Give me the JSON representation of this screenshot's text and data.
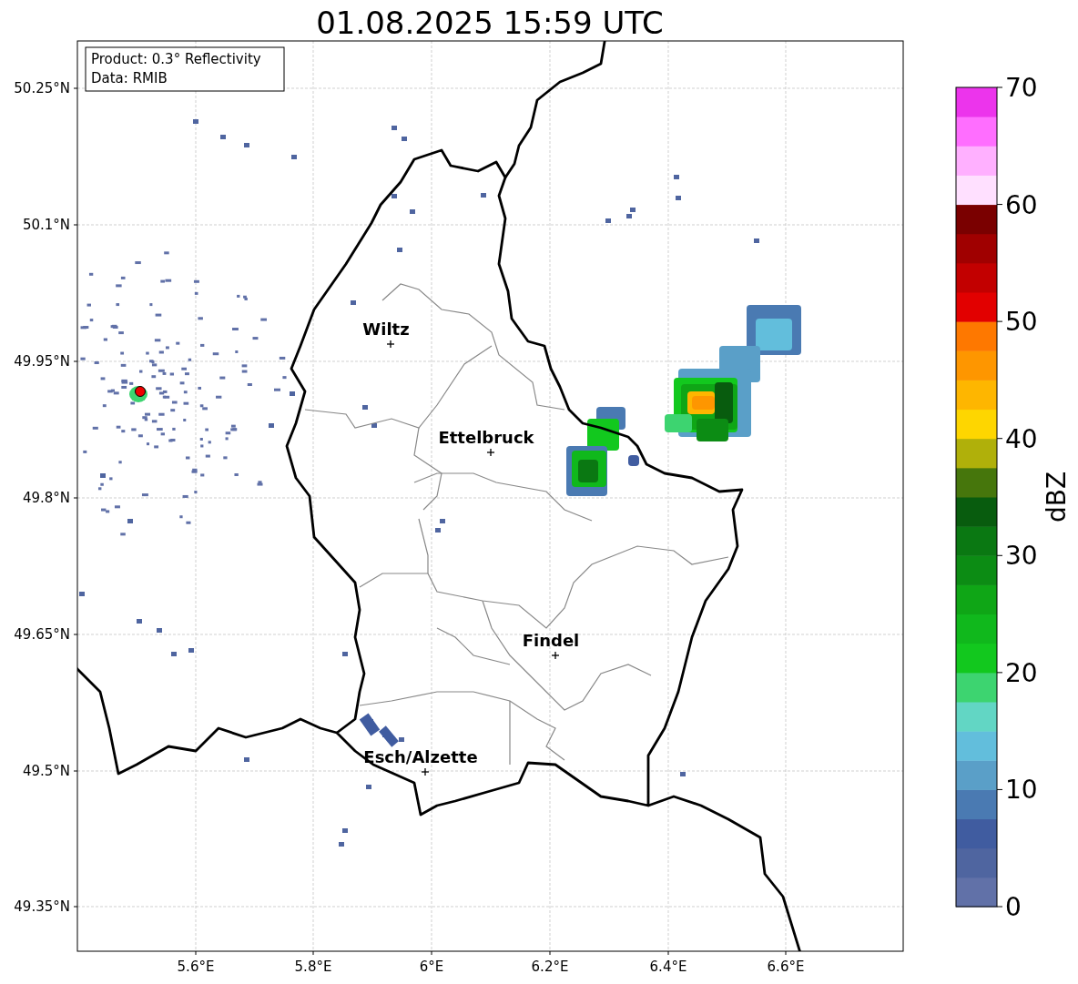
{
  "title": "01.08.2025 15:59 UTC",
  "info": [
    "Product: 0.3° Reflectivity",
    "Data: RMIB"
  ],
  "lat_ticks": [
    "50.25°N",
    "50.1°N",
    "49.95°N",
    "49.8°N",
    "49.65°N",
    "49.5°N",
    "49.35°N"
  ],
  "lon_ticks": [
    "5.6°E",
    "5.8°E",
    "6°E",
    "6.2°E",
    "6.4°E",
    "6.6°E"
  ],
  "cities": [
    {
      "name": "Wiltz"
    },
    {
      "name": "Ettelbruck"
    },
    {
      "name": "Findel"
    },
    {
      "name": "Esch/Alzette"
    }
  ],
  "colorbar": {
    "label": "dBZ",
    "ticks": [
      "70",
      "60",
      "50",
      "40",
      "30",
      "20",
      "10",
      "0"
    ],
    "bins": [
      {
        "color": "#6171a8"
      },
      {
        "color": "#4f65a0"
      },
      {
        "color": "#405ca0"
      },
      {
        "color": "#4a7ab2"
      },
      {
        "color": "#5a9fc8"
      },
      {
        "color": "#62bedc"
      },
      {
        "color": "#62d6c4"
      },
      {
        "color": "#3dd470"
      },
      {
        "color": "#12c81e"
      },
      {
        "color": "#10b81c"
      },
      {
        "color": "#0fa616"
      },
      {
        "color": "#0c8c14"
      },
      {
        "color": "#0a7812"
      },
      {
        "color": "#085c0e"
      },
      {
        "color": "#46760c"
      },
      {
        "color": "#b0b00a"
      },
      {
        "color": "#fed600"
      },
      {
        "color": "#feb600"
      },
      {
        "color": "#fe9600"
      },
      {
        "color": "#fe7800"
      },
      {
        "color": "#e20000"
      },
      {
        "color": "#c20000"
      },
      {
        "color": "#a00000"
      },
      {
        "color": "#7a0000"
      },
      {
        "color": "#ffe0ff"
      },
      {
        "color": "#ffb0ff"
      },
      {
        "color": "#ff6eff"
      },
      {
        "color": "#ec34ec"
      }
    ]
  }
}
